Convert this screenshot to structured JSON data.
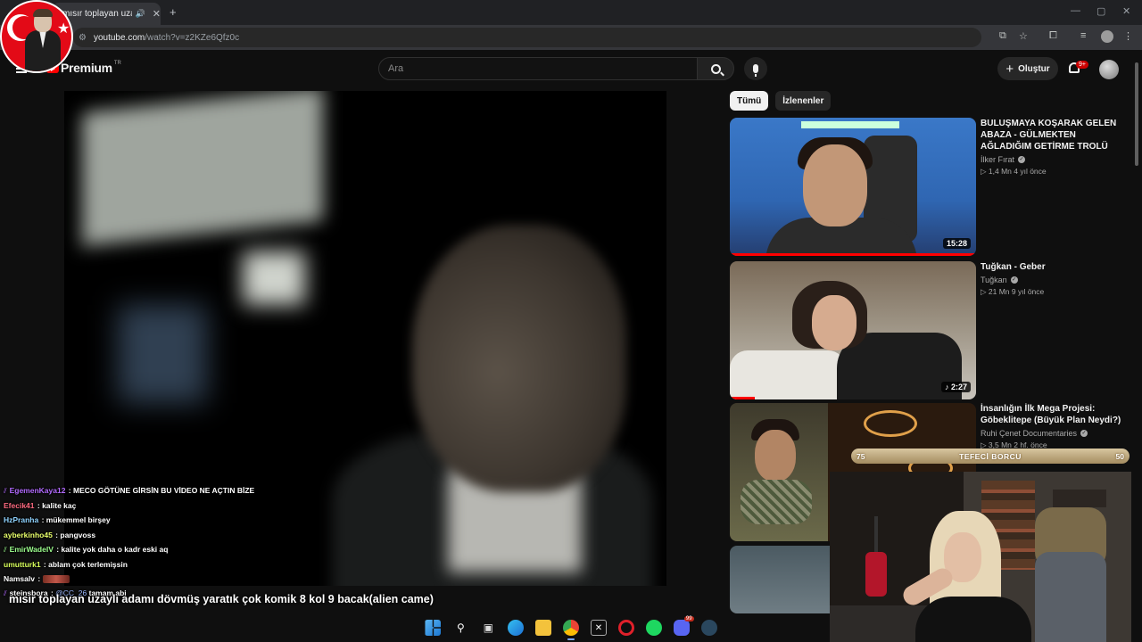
{
  "browser": {
    "tab_title": "mısır toplayan uzaylı adamı",
    "new_tab": "+",
    "url_host": "youtube.com",
    "url_path": "/watch?v=z2KZe6Qfz0c",
    "window_controls": [
      "—",
      "▢",
      "✕"
    ]
  },
  "header": {
    "brand": "Premium",
    "country": "TR",
    "search_placeholder": "Ara",
    "create_label": "Oluştur",
    "notification_badge": "9+"
  },
  "chips": [
    "Tümü",
    "İzlenenler"
  ],
  "recommendations": [
    {
      "title": "BULUŞMAYA KOŞARAK GELEN ABAZA - GÜLMEKTEN AĞLADIĞIM GETİRME TROLÜ",
      "channel": "İlker Fırat",
      "meta": "▷ 1,4 Mn   4 yıl önce",
      "duration": "15:28",
      "progress": 1.0
    },
    {
      "title": "Tuğkan - Geber",
      "channel": "Tuğkan",
      "meta": "▷ 21 Mn   9 yıl önce",
      "duration": "♪ 2:27",
      "progress": 0.1
    },
    {
      "title": "İnsanlığın İlk Mega Projesi: Göbeklitepe (Büyük Plan Neydi?)",
      "channel": "Ruhi Çenet Documentaries",
      "meta": "▷ 3,5 Mn   2 hf. önce",
      "duration": "",
      "progress": 0
    }
  ],
  "chat": [
    {
      "user": "EgemenKaya12",
      "color": "#b36bff",
      "message": "MECO GÖTÜNE GİRSİN BU VİDEO NE AÇTIN BİZE",
      "badge": "⫽",
      "bold_msg": true
    },
    {
      "user": "Efecik41",
      "color": "#ff6b81",
      "message": "kalite kaç",
      "badge": ""
    },
    {
      "user": "HzPranha",
      "color": "#8fd3ff",
      "message": "mükemmel birşey",
      "badge": ""
    },
    {
      "user": "ayberkinho45",
      "color": "#e9ff6b",
      "message": "pangvoss",
      "badge": ""
    },
    {
      "user": "EmirWadeIV",
      "color": "#9dff8f",
      "message": "kalite yok daha o kadr eski aq",
      "badge": "⫽"
    },
    {
      "user": "umutturk1",
      "color": "#d8ff5c",
      "message": "ablam çok terlemişsin",
      "badge": ""
    },
    {
      "user": "Namsalv",
      "color": "#ffffff",
      "message": "",
      "badge": "",
      "emote": true
    },
    {
      "user": "steinsbora",
      "color": "#ffffff",
      "message": "tamam abi",
      "mention": "@CC_26",
      "badge": "⫽"
    }
  ],
  "video_title": "mısır toplayan uzaylı adamı dövmüş yaratık çok komik 8 kol 9 bacak(alien came)",
  "tefeci": {
    "left": "75",
    "label": "TEFECİ BORCU",
    "right": "50",
    "level": 0.6
  },
  "taskbar": [
    "windows-start",
    "search",
    "task-view",
    "edge",
    "file-explorer",
    "chrome",
    "x-app",
    "opera",
    "spotify",
    "discord",
    "steam"
  ]
}
